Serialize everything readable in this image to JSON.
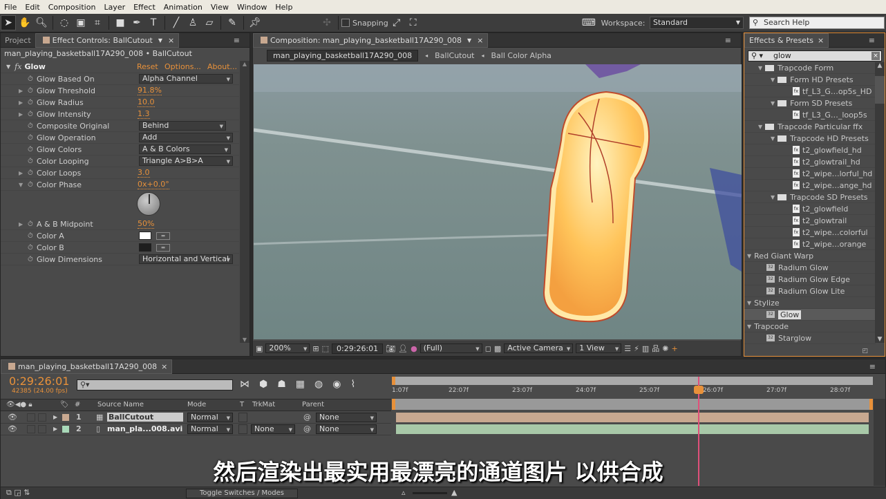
{
  "menu": [
    "File",
    "Edit",
    "Composition",
    "Layer",
    "Effect",
    "Animation",
    "View",
    "Window",
    "Help"
  ],
  "toolbar": {
    "snapping": "Snapping",
    "workspace_label": "Workspace:",
    "workspace": "Standard",
    "search_placeholder": "Search Help"
  },
  "left_panel": {
    "tab_project": "Project",
    "tab_effect_controls": "Effect Controls: BallCutout",
    "breadcrumb": "man_playing_basketball17A290_008 • BallCutout",
    "effect": {
      "name": "Glow",
      "reset": "Reset",
      "options": "Options...",
      "about": "About..."
    },
    "properties": [
      {
        "label": "Glow Based On",
        "type": "dropdown",
        "value": "Alpha Channel"
      },
      {
        "label": "Glow Threshold",
        "type": "value",
        "value": "91.8%",
        "expand": true
      },
      {
        "label": "Glow Radius",
        "type": "value",
        "value": "10.0",
        "expand": true
      },
      {
        "label": "Glow Intensity",
        "type": "value",
        "value": "1.3",
        "expand": true
      },
      {
        "label": "Composite Original",
        "type": "dropdown",
        "value": "Behind"
      },
      {
        "label": "Glow Operation",
        "type": "dropdown",
        "value": "Add"
      },
      {
        "label": "Glow Colors",
        "type": "dropdown",
        "value": "A & B Colors"
      },
      {
        "label": "Color Looping",
        "type": "dropdown",
        "value": "Triangle A>B>A"
      },
      {
        "label": "Color Loops",
        "type": "value",
        "value": "3.0",
        "expand": true
      },
      {
        "label": "Color Phase",
        "type": "value",
        "value": "0x+0.0°",
        "expanded": true
      },
      {
        "label": "A & B Midpoint",
        "type": "value",
        "value": "50%",
        "expand": true
      },
      {
        "label": "Color A",
        "type": "color",
        "value": "#ffffff"
      },
      {
        "label": "Color B",
        "type": "color",
        "value": "#1e1e1e"
      },
      {
        "label": "Glow Dimensions",
        "type": "dropdown",
        "value": "Horizontal and Vertical"
      }
    ]
  },
  "comp_panel": {
    "tab": "Composition: man_playing_basketball17A290_008",
    "crumbs": [
      "man_playing_basketball17A290_008",
      "BallCutout",
      "Ball Color Alpha"
    ],
    "zoom": "200%",
    "timecode": "0:29:26:01",
    "resolution": "(Full)",
    "camera": "Active Camera",
    "views": "1 View"
  },
  "effects_panel": {
    "tab": "Effects & Presets",
    "search": "glow",
    "items": [
      {
        "label": "Trapcode Form",
        "kind": "folder",
        "level": 1
      },
      {
        "label": "Form HD Presets",
        "kind": "folder",
        "level": 2
      },
      {
        "label": "tf_L3_G…op5s_HD",
        "kind": "preset",
        "level": 3
      },
      {
        "label": "Form SD Presets",
        "kind": "folder",
        "level": 2
      },
      {
        "label": "tf_L3_G…_loop5s",
        "kind": "preset",
        "level": 3
      },
      {
        "label": "Trapcode Particular ffx",
        "kind": "folder",
        "level": 1
      },
      {
        "label": "Trapcode HD Presets",
        "kind": "folder",
        "level": 2
      },
      {
        "label": "t2_glowfield_hd",
        "kind": "preset",
        "level": 3
      },
      {
        "label": "t2_glowtrail_hd",
        "kind": "preset",
        "level": 3
      },
      {
        "label": "t2_wipe…lorful_hd",
        "kind": "preset",
        "level": 3
      },
      {
        "label": "t2_wipe…ange_hd",
        "kind": "preset",
        "level": 3
      },
      {
        "label": "Trapcode SD Presets",
        "kind": "folder",
        "level": 2
      },
      {
        "label": "t2_glowfield",
        "kind": "preset",
        "level": 3
      },
      {
        "label": "t2_glowtrail",
        "kind": "preset",
        "level": 3
      },
      {
        "label": "t2_wipe…colorful",
        "kind": "preset",
        "level": 3
      },
      {
        "label": "t2_wipe…orange",
        "kind": "preset",
        "level": 3
      },
      {
        "label": "Red Giant Warp",
        "kind": "category",
        "level": 0
      },
      {
        "label": "Radium Glow",
        "kind": "effect",
        "level": 1
      },
      {
        "label": "Radium Glow Edge",
        "kind": "effect",
        "level": 1
      },
      {
        "label": "Radium Glow Lite",
        "kind": "effect",
        "level": 1
      },
      {
        "label": "Stylize",
        "kind": "category",
        "level": 0
      },
      {
        "label": "Glow",
        "kind": "effect",
        "level": 1,
        "selected": true
      },
      {
        "label": "Trapcode",
        "kind": "category",
        "level": 0
      },
      {
        "label": "Starglow",
        "kind": "effect",
        "level": 1
      }
    ]
  },
  "timeline": {
    "tab": "man_playing_basketball17A290_008",
    "timecode": "0:29:26:01",
    "frames": "42385 (24.00 fps)",
    "columns": {
      "num": "#",
      "source": "Source Name",
      "mode": "Mode",
      "t": "T",
      "trkmat": "TrkMat",
      "parent": "Parent"
    },
    "layers": [
      {
        "num": "1",
        "name": "BallCutout",
        "mode": "Normal",
        "trkmat": "",
        "parent": "None",
        "color": "#c8a890"
      },
      {
        "num": "2",
        "name": "man_pla...008.avi",
        "mode": "Normal",
        "trkmat": "None",
        "parent": "None",
        "color": "#a8d8b8"
      }
    ],
    "ruler": [
      "1:07f",
      "22:07f",
      "23:07f",
      "24:07f",
      "25:07f",
      "26:07f",
      "27:07f",
      "28:07f"
    ],
    "toggle": "Toggle Switches / Modes"
  },
  "subtitle": "然后渲染出最实用最漂亮的通道图片 以供合成",
  "colors": {
    "accent": "#e8913a",
    "playhead": "#e0507a"
  }
}
